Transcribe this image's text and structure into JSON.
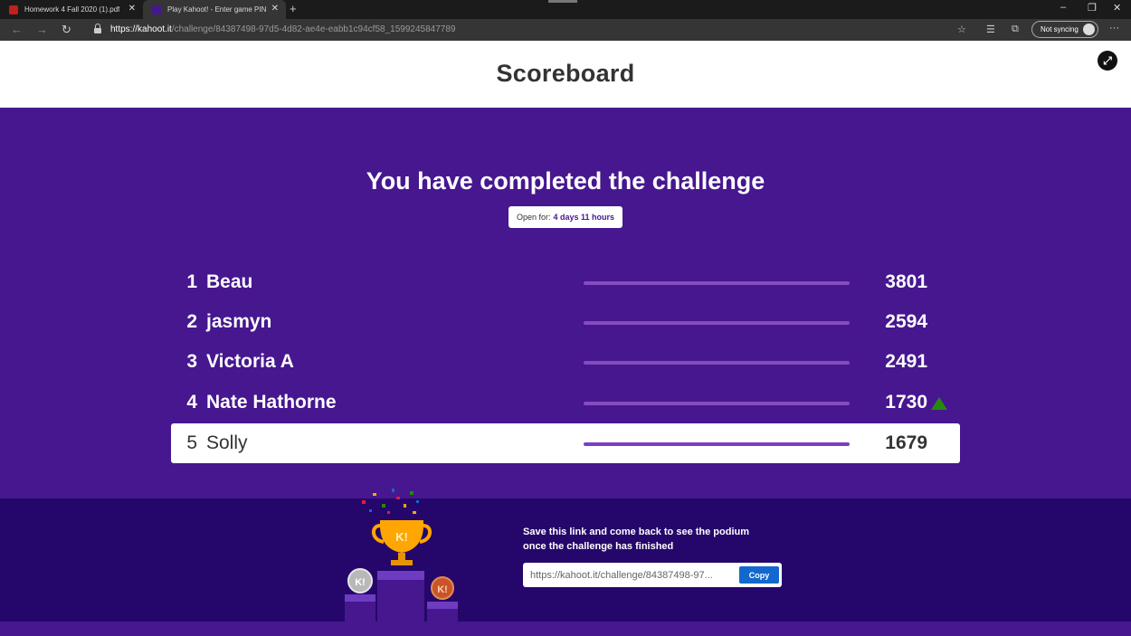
{
  "browser": {
    "tabs": [
      {
        "title": "Homework 4 Fall 2020 (1).pdf",
        "active": false
      },
      {
        "title": "Play Kahoot! - Enter game PIN h",
        "active": true
      }
    ],
    "url_prefix": "https://",
    "url_domain": "kahoot.it",
    "url_path": "/challenge/84387498-97d5-4d82-ae4e-eabb1c94cf58_1599245847789",
    "sync_label": "Not syncing"
  },
  "header": {
    "title": "Scoreboard"
  },
  "challenge": {
    "headline": "You have completed the challenge",
    "open_for_label": "Open for:",
    "open_for_value": "4 days 11 hours"
  },
  "scoreboard": [
    {
      "rank": "1",
      "name": "Beau",
      "score": "3801",
      "trend": null
    },
    {
      "rank": "2",
      "name": "jasmyn",
      "score": "2594",
      "trend": null
    },
    {
      "rank": "3",
      "name": "Victoria A",
      "score": "2491",
      "trend": null
    },
    {
      "rank": "4",
      "name": "Nate Hathorne",
      "score": "1730",
      "trend": "up"
    },
    {
      "rank": "5",
      "name": "Solly",
      "score": "1679",
      "trend": null,
      "current_player": true
    }
  ],
  "footer": {
    "save_line1": "Save this link and come back to see the podium",
    "save_line2": "once the challenge has finished",
    "link_value": "https://kahoot.it/challenge/84387498-97...",
    "copy_label": "Copy"
  },
  "colors": {
    "brand_purple": "#46178f",
    "footer_purple": "#25076b",
    "copy_blue": "#1368ce",
    "trend_up_green": "#26890c"
  }
}
